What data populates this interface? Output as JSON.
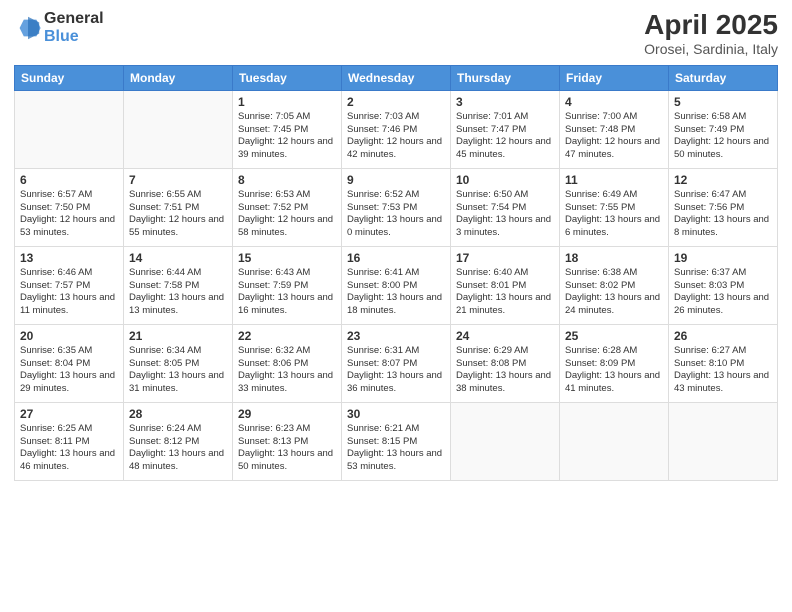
{
  "logo": {
    "general": "General",
    "blue": "Blue"
  },
  "title": {
    "month": "April 2025",
    "location": "Orosei, Sardinia, Italy"
  },
  "headers": [
    "Sunday",
    "Monday",
    "Tuesday",
    "Wednesday",
    "Thursday",
    "Friday",
    "Saturday"
  ],
  "weeks": [
    [
      {
        "day": "",
        "info": ""
      },
      {
        "day": "",
        "info": ""
      },
      {
        "day": "1",
        "info": "Sunrise: 7:05 AM\nSunset: 7:45 PM\nDaylight: 12 hours and 39 minutes."
      },
      {
        "day": "2",
        "info": "Sunrise: 7:03 AM\nSunset: 7:46 PM\nDaylight: 12 hours and 42 minutes."
      },
      {
        "day": "3",
        "info": "Sunrise: 7:01 AM\nSunset: 7:47 PM\nDaylight: 12 hours and 45 minutes."
      },
      {
        "day": "4",
        "info": "Sunrise: 7:00 AM\nSunset: 7:48 PM\nDaylight: 12 hours and 47 minutes."
      },
      {
        "day": "5",
        "info": "Sunrise: 6:58 AM\nSunset: 7:49 PM\nDaylight: 12 hours and 50 minutes."
      }
    ],
    [
      {
        "day": "6",
        "info": "Sunrise: 6:57 AM\nSunset: 7:50 PM\nDaylight: 12 hours and 53 minutes."
      },
      {
        "day": "7",
        "info": "Sunrise: 6:55 AM\nSunset: 7:51 PM\nDaylight: 12 hours and 55 minutes."
      },
      {
        "day": "8",
        "info": "Sunrise: 6:53 AM\nSunset: 7:52 PM\nDaylight: 12 hours and 58 minutes."
      },
      {
        "day": "9",
        "info": "Sunrise: 6:52 AM\nSunset: 7:53 PM\nDaylight: 13 hours and 0 minutes."
      },
      {
        "day": "10",
        "info": "Sunrise: 6:50 AM\nSunset: 7:54 PM\nDaylight: 13 hours and 3 minutes."
      },
      {
        "day": "11",
        "info": "Sunrise: 6:49 AM\nSunset: 7:55 PM\nDaylight: 13 hours and 6 minutes."
      },
      {
        "day": "12",
        "info": "Sunrise: 6:47 AM\nSunset: 7:56 PM\nDaylight: 13 hours and 8 minutes."
      }
    ],
    [
      {
        "day": "13",
        "info": "Sunrise: 6:46 AM\nSunset: 7:57 PM\nDaylight: 13 hours and 11 minutes."
      },
      {
        "day": "14",
        "info": "Sunrise: 6:44 AM\nSunset: 7:58 PM\nDaylight: 13 hours and 13 minutes."
      },
      {
        "day": "15",
        "info": "Sunrise: 6:43 AM\nSunset: 7:59 PM\nDaylight: 13 hours and 16 minutes."
      },
      {
        "day": "16",
        "info": "Sunrise: 6:41 AM\nSunset: 8:00 PM\nDaylight: 13 hours and 18 minutes."
      },
      {
        "day": "17",
        "info": "Sunrise: 6:40 AM\nSunset: 8:01 PM\nDaylight: 13 hours and 21 minutes."
      },
      {
        "day": "18",
        "info": "Sunrise: 6:38 AM\nSunset: 8:02 PM\nDaylight: 13 hours and 24 minutes."
      },
      {
        "day": "19",
        "info": "Sunrise: 6:37 AM\nSunset: 8:03 PM\nDaylight: 13 hours and 26 minutes."
      }
    ],
    [
      {
        "day": "20",
        "info": "Sunrise: 6:35 AM\nSunset: 8:04 PM\nDaylight: 13 hours and 29 minutes."
      },
      {
        "day": "21",
        "info": "Sunrise: 6:34 AM\nSunset: 8:05 PM\nDaylight: 13 hours and 31 minutes."
      },
      {
        "day": "22",
        "info": "Sunrise: 6:32 AM\nSunset: 8:06 PM\nDaylight: 13 hours and 33 minutes."
      },
      {
        "day": "23",
        "info": "Sunrise: 6:31 AM\nSunset: 8:07 PM\nDaylight: 13 hours and 36 minutes."
      },
      {
        "day": "24",
        "info": "Sunrise: 6:29 AM\nSunset: 8:08 PM\nDaylight: 13 hours and 38 minutes."
      },
      {
        "day": "25",
        "info": "Sunrise: 6:28 AM\nSunset: 8:09 PM\nDaylight: 13 hours and 41 minutes."
      },
      {
        "day": "26",
        "info": "Sunrise: 6:27 AM\nSunset: 8:10 PM\nDaylight: 13 hours and 43 minutes."
      }
    ],
    [
      {
        "day": "27",
        "info": "Sunrise: 6:25 AM\nSunset: 8:11 PM\nDaylight: 13 hours and 46 minutes."
      },
      {
        "day": "28",
        "info": "Sunrise: 6:24 AM\nSunset: 8:12 PM\nDaylight: 13 hours and 48 minutes."
      },
      {
        "day": "29",
        "info": "Sunrise: 6:23 AM\nSunset: 8:13 PM\nDaylight: 13 hours and 50 minutes."
      },
      {
        "day": "30",
        "info": "Sunrise: 6:21 AM\nSunset: 8:15 PM\nDaylight: 13 hours and 53 minutes."
      },
      {
        "day": "",
        "info": ""
      },
      {
        "day": "",
        "info": ""
      },
      {
        "day": "",
        "info": ""
      }
    ]
  ]
}
